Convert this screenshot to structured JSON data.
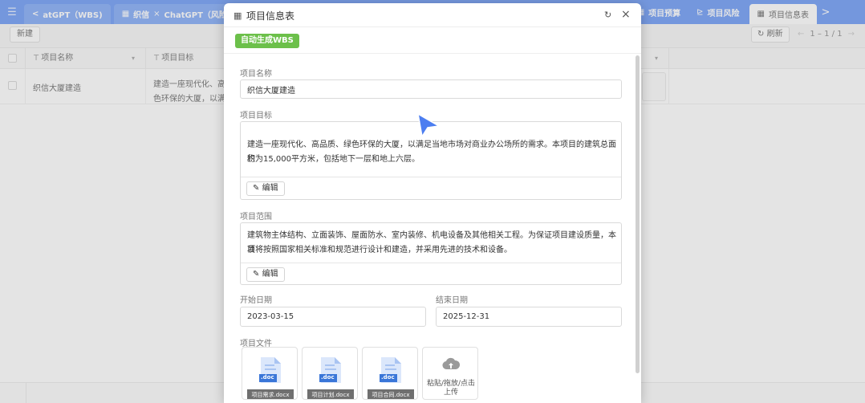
{
  "tabs": {
    "menu_icon": "menu-icon",
    "back_glyph": "<",
    "items": [
      {
        "label": "atGPT（WBS)"
      },
      {
        "label": "织信",
        "close_glyph": "×",
        "label2": "ChatGPT（风险报告)"
      },
      {
        "label": "项目预算"
      },
      {
        "label": "项目风险"
      },
      {
        "label": "项目信息表"
      }
    ],
    "forward_glyph": ">"
  },
  "toolbar": {
    "new_label": "新建",
    "refresh_label": "刷新",
    "pager_prev": "←",
    "pager_text": "1 – 1 / 1",
    "pager_next": "→"
  },
  "grid": {
    "columns": [
      {
        "label": "项目名称"
      },
      {
        "label": "项目目标"
      }
    ],
    "rows": [
      {
        "name": "织信大厦建造",
        "goal_line1": "建造一座现代化、高",
        "goal_line2": "色环保的大厦，以满"
      }
    ]
  },
  "dialog": {
    "title": "项目信息表",
    "wbs_button": "自动生成WBS",
    "fields": {
      "name_label": "项目名称",
      "name_value": "织信大厦建造",
      "goal_label": "项目目标",
      "goal_line1": "建造一座现代化、高品质、绿色环保的大厦，以满足当地市场对商业办公场所的需求。本项目的建筑总面积",
      "goal_line2": "约为15,000平方米，包括地下一层和地上六层。",
      "scope_label": "项目范围",
      "scope_line1": "建筑物主体结构、立面装饰、屋面防水、室内装修、机电设备及其他相关工程。为保证项目建设质量，本项",
      "scope_line2": "目将按照国家相关标准和规范进行设计和建造，并采用先进的技术和设备。",
      "edit_label": "编辑",
      "start_label": "开始日期",
      "start_value": "2023-03-15",
      "end_label": "结束日期",
      "end_value": "2025-12-31",
      "files_label": "项目文件"
    },
    "files": [
      {
        "ext": ".doc",
        "name": "项目需求.docx"
      },
      {
        "ext": ".doc",
        "name": "项目计划.docx"
      },
      {
        "ext": ".doc",
        "name": "项目合同.docx"
      }
    ],
    "upload_line1": "粘贴/拖放/点击",
    "upload_line2": "上传"
  },
  "colors": {
    "tabbar": "#3f7bf3",
    "wbs_green": "#6cc04a",
    "doc_blue": "#3a76d8",
    "cursor_blue": "#4c7ef0"
  }
}
